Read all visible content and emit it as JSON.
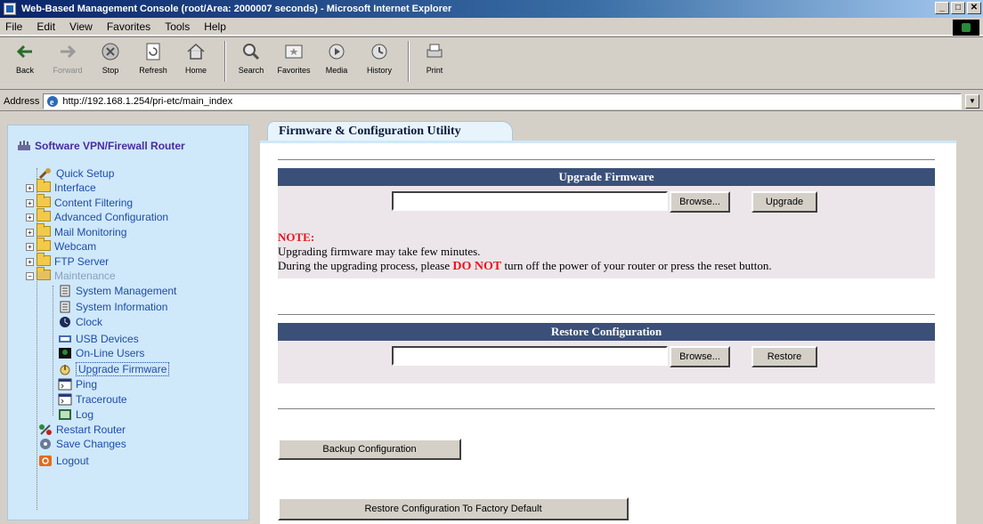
{
  "window": {
    "title": "Web-Based Management Console (root/Area: 2000007 seconds) - Microsoft Internet Explorer",
    "controls": [
      "_",
      "□",
      "✕"
    ]
  },
  "menubar": [
    "File",
    "Edit",
    "View",
    "Favorites",
    "Tools",
    "Help"
  ],
  "toolbar": [
    {
      "label": "Back",
      "icon": "back-arrow-icon",
      "enabled": true
    },
    {
      "label": "Forward",
      "icon": "forward-arrow-icon",
      "enabled": false
    },
    {
      "label": "Stop",
      "icon": "stop-icon",
      "enabled": true
    },
    {
      "label": "Refresh",
      "icon": "refresh-icon",
      "enabled": true
    },
    {
      "label": "Home",
      "icon": "home-icon",
      "enabled": true
    },
    {
      "label": "Search",
      "icon": "search-icon",
      "enabled": true
    },
    {
      "label": "Favorites",
      "icon": "favorites-icon",
      "enabled": true
    },
    {
      "label": "Media",
      "icon": "media-icon",
      "enabled": true
    },
    {
      "label": "History",
      "icon": "history-icon",
      "enabled": true
    },
    {
      "label": "Print",
      "icon": "print-icon",
      "enabled": true
    }
  ],
  "address": {
    "label": "Address",
    "url": "http://192.168.1.254/pri-etc/main_index"
  },
  "tree": {
    "root": "Software VPN/Firewall Router",
    "items": [
      {
        "label": "Quick Setup",
        "icon": "wrench-icon",
        "expander": "",
        "level": 1
      },
      {
        "label": "Interface",
        "icon": "folder-icon",
        "expander": "+",
        "level": 1
      },
      {
        "label": "Content Filtering",
        "icon": "folder-icon",
        "expander": "+",
        "level": 1
      },
      {
        "label": "Advanced Configuration",
        "icon": "folder-icon",
        "expander": "+",
        "level": 1
      },
      {
        "label": "Mail Monitoring",
        "icon": "folder-icon",
        "expander": "+",
        "level": 1
      },
      {
        "label": "Webcam",
        "icon": "folder-icon",
        "expander": "+",
        "level": 1
      },
      {
        "label": "FTP Server",
        "icon": "folder-icon",
        "expander": "+",
        "level": 1
      },
      {
        "label": "Maintenance",
        "icon": "open-folder-icon",
        "expander": "−",
        "level": 1,
        "dim": true
      },
      {
        "label": "System Management",
        "icon": "document-icon",
        "expander": "",
        "level": 2
      },
      {
        "label": "System Information",
        "icon": "document-icon",
        "expander": "",
        "level": 2
      },
      {
        "label": "Clock",
        "icon": "clock-icon",
        "expander": "",
        "level": 2
      },
      {
        "label": "USB Devices",
        "icon": "usb-icon",
        "expander": "",
        "level": 2
      },
      {
        "label": "On-Line Users",
        "icon": "users-icon",
        "expander": "",
        "level": 2
      },
      {
        "label": "Upgrade Firmware",
        "icon": "upgrade-icon",
        "expander": "",
        "level": 2,
        "selected": true
      },
      {
        "label": "Ping",
        "icon": "terminal-icon",
        "expander": "",
        "level": 2
      },
      {
        "label": "Traceroute",
        "icon": "terminal-icon",
        "expander": "",
        "level": 2
      },
      {
        "label": "Log",
        "icon": "log-icon",
        "expander": "",
        "level": 2
      },
      {
        "label": "Restart Router",
        "icon": "restart-icon",
        "expander": "",
        "level": 1
      },
      {
        "label": "Save Changes",
        "icon": "save-icon",
        "expander": "",
        "level": 1
      },
      {
        "label": "Logout",
        "icon": "logout-icon",
        "expander": "",
        "level": 1
      }
    ]
  },
  "main": {
    "tab_title": "Firmware & Configuration Utility",
    "upgrade": {
      "header": "Upgrade Firmware",
      "file_value": "",
      "browse_label": "Browse...",
      "action_label": "Upgrade",
      "note_title": "NOTE:",
      "note_line1": "Upgrading firmware may take few minutes.",
      "note_line2_pre": "During the upgrading process, please ",
      "note_line2_warn": "DO NOT",
      "note_line2_post": " turn off the power of your router or press the reset button."
    },
    "restore": {
      "header": "Restore Configuration",
      "file_value": "",
      "browse_label": "Browse...",
      "action_label": "Restore"
    },
    "backup_label": "Backup Configuration",
    "factory_label": "Restore Configuration To Factory Default"
  }
}
